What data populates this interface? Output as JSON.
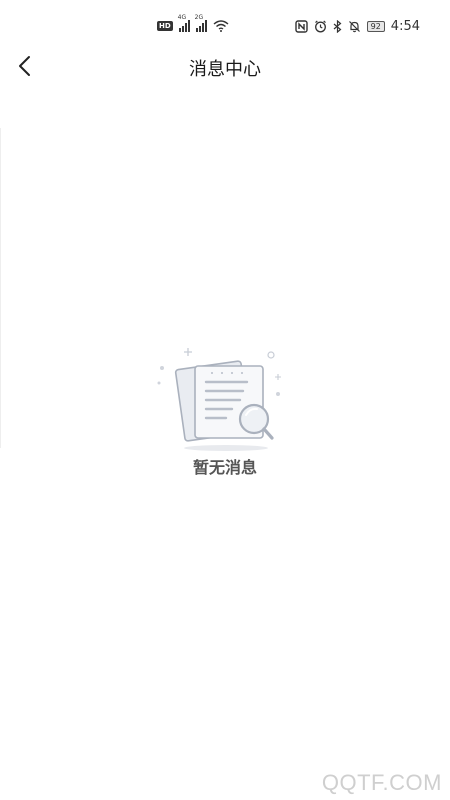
{
  "status_bar": {
    "network_badge": "HD",
    "signal_1_gen": "4G",
    "signal_2_gen": "2G",
    "battery": "92",
    "time": "4:54"
  },
  "nav": {
    "title": "消息中心"
  },
  "empty_state": {
    "text": "暂无消息",
    "icon": "document-search-icon"
  },
  "watermark": "QQTF.COM"
}
